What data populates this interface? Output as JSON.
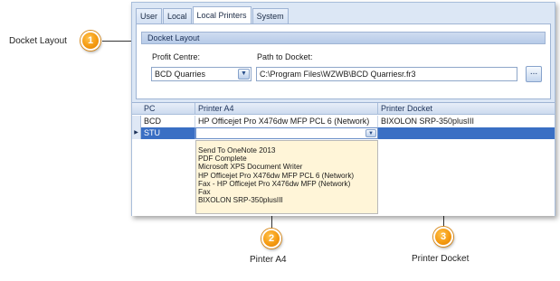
{
  "callouts": [
    {
      "number": "1",
      "label": "Docket Layout"
    },
    {
      "number": "2",
      "label": "Pinter A4"
    },
    {
      "number": "3",
      "label": "Printer Docket"
    }
  ],
  "tabs": [
    {
      "label": "User",
      "active": false
    },
    {
      "label": "Local",
      "active": false
    },
    {
      "label": "Local Printers",
      "active": true
    },
    {
      "label": "System",
      "active": false
    }
  ],
  "docket_layout": {
    "group_title": "Docket Layout",
    "profit_centre_label": "Profit Centre:",
    "profit_centre_value": "BCD Quarries",
    "path_label": "Path to Docket:",
    "path_value": "C:\\Program Files\\WZWB\\BCD Quarriesr.fr3",
    "browse_label": "..."
  },
  "grid": {
    "headers": [
      "PC",
      "Printer A4",
      "Printer Docket"
    ],
    "rows": [
      {
        "pc": "BCD",
        "printer_a4": "HP Officejet Pro X476dw MFP PCL 6 (Network)",
        "printer_docket": "BIXOLON SRP-350plusIII",
        "selected": false
      },
      {
        "pc": "STU",
        "printer_a4": "",
        "printer_docket": "",
        "selected": true
      }
    ]
  },
  "dropdown_options": [
    "Send To OneNote 2013",
    "PDF Complete",
    "Microsoft XPS Document Writer",
    "HP Officejet Pro X476dw MFP PCL 6 (Network)",
    "Fax - HP Officejet Pro X476dw MFP (Network)",
    "Fax",
    "BIXOLON SRP-350plusIII"
  ],
  "icons": {
    "combo_arrow": "chevron-down-icon",
    "row_pointer": "row-pointer-icon"
  },
  "colors": {
    "badge": "#f59b12",
    "selection": "#3a6fc4",
    "dropdown_bg": "#fff5d8"
  }
}
